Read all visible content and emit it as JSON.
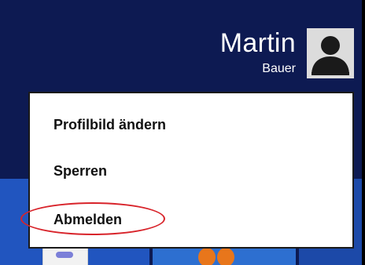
{
  "user": {
    "first_name": "Martin",
    "last_name": "Bauer",
    "avatar_icon": "default-user-icon"
  },
  "menu": {
    "items": [
      {
        "label": "Profilbild ändern"
      },
      {
        "label": "Sperren"
      },
      {
        "label": "Abmelden"
      }
    ],
    "highlighted_item": "Abmelden"
  },
  "colors": {
    "background": "#0d1a52",
    "menu_background": "#ffffff",
    "highlight": "#d8232a"
  }
}
